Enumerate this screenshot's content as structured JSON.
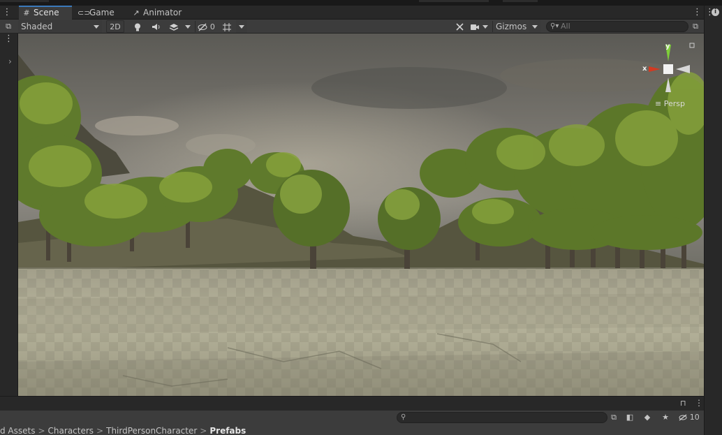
{
  "tabs": [
    {
      "label": "Scene",
      "icon": "grid-icon",
      "active": true
    },
    {
      "label": "Game",
      "icon": "gamepad-icon",
      "active": false
    },
    {
      "label": "Animator",
      "icon": "animator-icon",
      "active": false
    }
  ],
  "toolbar": {
    "shading_mode": "Shaded",
    "mode_2d_label": "2D",
    "hidden_count": "0",
    "gizmos_label": "Gizmos",
    "search_placeholder": "All"
  },
  "scene_gizmo": {
    "projection_label": "Persp",
    "axis_x": "x",
    "axis_y": "y"
  },
  "project_toolbar": {
    "hidden_count": "10"
  },
  "breadcrumb": [
    "d Assets",
    "Characters",
    "ThirdPersonCharacter",
    "Prefabs"
  ],
  "colors": {
    "accent": "#3a79bb",
    "panel": "#282828",
    "toolbar": "#3c3c3c",
    "axis_x": "#d23a22",
    "axis_y": "#7fcf3a"
  }
}
